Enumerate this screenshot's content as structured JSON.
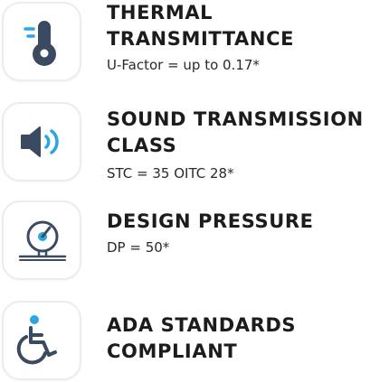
{
  "accent_color": "#3a4a60",
  "accent_blue": "#2aa6e0",
  "features": [
    {
      "icon": "thermometer-icon",
      "title_lines": [
        "THERMAL",
        "TRANSMITTANCE"
      ],
      "spec": "U-Factor = up to 0.17*"
    },
    {
      "icon": "speaker-icon",
      "title_lines": [
        "SOUND TRANSMISSION",
        "CLASS"
      ],
      "spec": "STC = 35 OITC 28*"
    },
    {
      "icon": "pressure-gauge-icon",
      "title_lines": [
        "DESIGN PRESSURE"
      ],
      "spec": "DP = 50*"
    },
    {
      "icon": "wheelchair-icon",
      "title_lines": [
        "ADA STANDARDS",
        "COMPLIANT"
      ],
      "spec": ""
    }
  ]
}
